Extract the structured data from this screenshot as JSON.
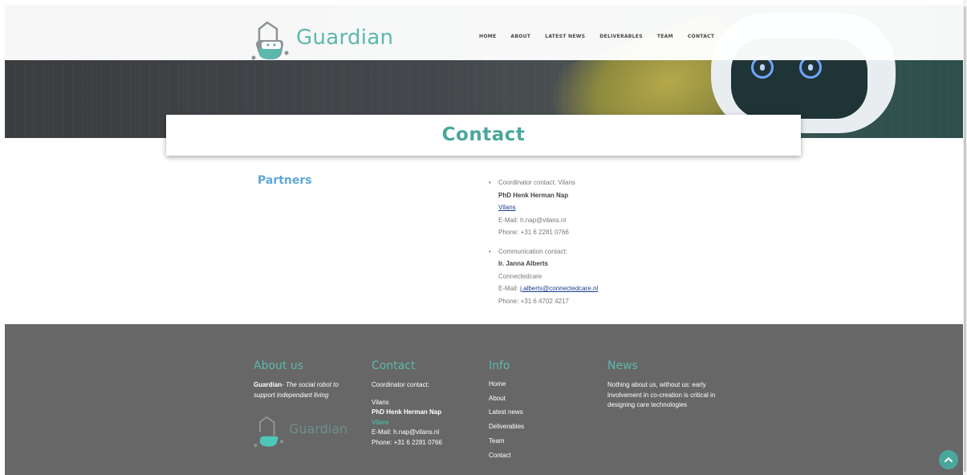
{
  "header": {
    "logo_text": "Guardian",
    "nav": [
      "HOME",
      "ABOUT",
      "LATEST NEWS",
      "DELIVERABLES",
      "TEAM",
      "CONTACT"
    ]
  },
  "page": {
    "title": "Contact"
  },
  "partners": {
    "heading": "Partners",
    "contacts": [
      {
        "role": "Coordinator contact: Vilans",
        "name": "PhD Henk Herman Nap",
        "org": "Vilans",
        "email_label": "E-Mail: h.nap@vilans.nl",
        "phone": "Phone: +31 6 2281 0766"
      },
      {
        "role": "Communication contact:",
        "name": "Ir. Janna Alberts",
        "org": "Connectedcare",
        "email_prefix": "E-Mail: ",
        "email_link": "j.alberts@connectedcare.nl",
        "phone": "Phone: +31 6 4702 4217"
      }
    ]
  },
  "footer": {
    "about": {
      "heading": "About us",
      "brand": "Guardian",
      "tagline": "- The social robot to support independant living",
      "logo_text": "Guardian"
    },
    "contact": {
      "heading": "Contact",
      "line1": "Coordinator contact:",
      "org": "Vilans",
      "name": "PhD Henk Herman Nap",
      "link": "Vilans",
      "email": "E-Mail: h.nap@vilans.nl",
      "phone": "Phone: +31 6 2281 0766"
    },
    "info": {
      "heading": "Info",
      "links": [
        "Home",
        "About",
        "Latest news",
        "Deliverables",
        "Team",
        "Contact"
      ]
    },
    "news": {
      "heading": "News",
      "item": "Nothing about us, without us: early involvement in co-creation is critical in designing care technologies"
    }
  },
  "colors": {
    "accent": "#4aa79c",
    "partners_heading": "#5ea8d9",
    "footer_bg": "#676767"
  },
  "icons": {
    "logo": "robot-house-icon",
    "back_to_top": "chevron-up-icon"
  }
}
